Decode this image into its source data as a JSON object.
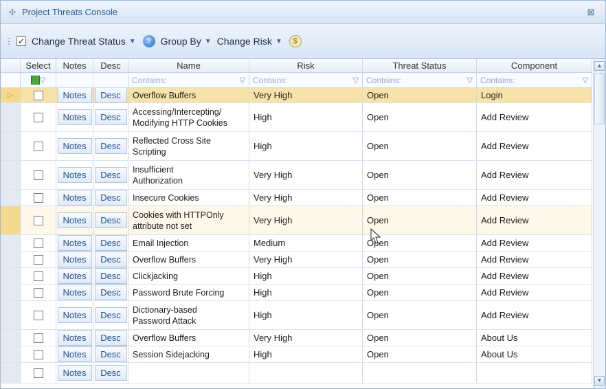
{
  "window": {
    "title": "Project Threats Console",
    "close_glyph": "⊠"
  },
  "toolbar": {
    "change_threat_status": "Change Threat Status",
    "group_by": "Group By",
    "change_risk": "Change Risk",
    "checkbox_checked": true
  },
  "columns": {
    "select": "Select",
    "notes": "Notes",
    "desc": "Desc",
    "name": "Name",
    "risk": "Risk",
    "threat_status": "Threat Status",
    "component": "Component"
  },
  "filters": {
    "name": "Contains:",
    "risk": "Contains:",
    "threat_status": "Contains:",
    "component": "Contains:"
  },
  "button_labels": {
    "notes": "Notes",
    "desc": "Desc"
  },
  "rows": [
    {
      "name": "Overflow Buffers",
      "risk": "Very High",
      "status": "Open",
      "component": "Login",
      "state": "selected"
    },
    {
      "name": "Accessing/Intercepting/\nModifying HTTP Cookies",
      "risk": "High",
      "status": "Open",
      "component": "Add Review",
      "state": ""
    },
    {
      "name": "Reflected Cross Site\nScripting",
      "risk": "High",
      "status": "Open",
      "component": "Add Review",
      "state": ""
    },
    {
      "name": "Insufficient\nAuthorization",
      "risk": "Very High",
      "status": "Open",
      "component": "Add Review",
      "state": ""
    },
    {
      "name": "Insecure Cookies",
      "risk": "Very High",
      "status": "Open",
      "component": "Add Review",
      "state": ""
    },
    {
      "name": "Cookies with HTTPOnly\nattribute not set",
      "risk": "Very High",
      "status": "Open",
      "component": "Add Review",
      "state": "hover"
    },
    {
      "name": "Email Injection",
      "risk": "Medium",
      "status": "Open",
      "component": "Add Review",
      "state": ""
    },
    {
      "name": "Overflow Buffers",
      "risk": "Very High",
      "status": "Open",
      "component": "Add Review",
      "state": ""
    },
    {
      "name": "Clickjacking",
      "risk": "High",
      "status": "Open",
      "component": "Add Review",
      "state": ""
    },
    {
      "name": "Password Brute Forcing",
      "risk": "High",
      "status": "Open",
      "component": "Add Review",
      "state": ""
    },
    {
      "name": "Dictionary-based\nPassword Attack",
      "risk": "High",
      "status": "Open",
      "component": "Add Review",
      "state": ""
    },
    {
      "name": "Overflow Buffers",
      "risk": "Very High",
      "status": "Open",
      "component": "About Us",
      "state": ""
    },
    {
      "name": "Session Sidejacking",
      "risk": "High",
      "status": "Open",
      "component": "About Us",
      "state": ""
    },
    {
      "name": "",
      "risk": "",
      "status": "",
      "component": "",
      "state": ""
    }
  ]
}
